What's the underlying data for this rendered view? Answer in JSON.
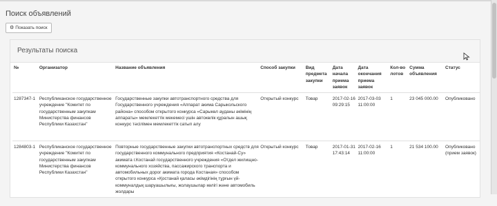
{
  "page": {
    "title": "Поиск объявлений"
  },
  "search_button": {
    "label": "Показать поиск",
    "icon": "gear-icon"
  },
  "results": {
    "title": "Результаты поиска",
    "columns": {
      "num": "№",
      "organizer": "Организатор",
      "name": "Название объявления",
      "method": "Способ закупки",
      "subject_type": "Вид предмета закупки",
      "start_date": "Дата начала приема заявок",
      "end_date": "Дата окончания приема заявок",
      "lots": "Кол-во лотов",
      "sum": "Сумма объявления",
      "status": "Статус"
    },
    "rows": [
      {
        "num": "1287347-1",
        "organizer": "Республиканское государственное учреждение \"Комитет по государственным закупкам Министерства финансов Республики Казахстан\"",
        "name": "Государственные закупки автотранспортного средства для Государственного учреждения «Аппарат акима Сарыкольского района» способом открытого конкурса «Сарыкөл ауданы әкімінің аппараты» мемлекеттік мекемесі үшін автокөлік құралын ашық конкурс тәсілімен мемлекеттік сатып алу",
        "method": "Открытый конкурс",
        "subject_type": "Товар",
        "start_date": "2017-02-16 09:29:15",
        "end_date": "2017-03-03 11:00:00",
        "lots": "1",
        "sum": "23 045 000.00",
        "status": "Опубликовано"
      },
      {
        "num": "1284803-1",
        "organizer": "Республиканское государственное учреждение \"Комитет по государственным закупкам Министерства финансов Республики Казахстан\"",
        "name": "Повторные государственные закупки автотранспортных средств для государственного коммунального предприятия «Костанай-Су» акимата г.Костанай государственного учреждения «Отдел жилищно-коммунального хозяйства, пассажирского транспорта и автомобильных дорог акимата города Костаная» способом открытого конкурса «Қостанай қаласы әкімдігінің тұрғын үй-коммуналдық шаруашылығы, жолаушылар көлігі және автомобиль жолдары",
        "method": "Открытый конкурс",
        "subject_type": "Товар",
        "start_date": "2017-01-31 17:43:14",
        "end_date": "2017-02-16 11:00:00",
        "lots": "1",
        "sum": "21 534 100.00",
        "status": "Опубликовано (прием заявок)"
      }
    ]
  }
}
